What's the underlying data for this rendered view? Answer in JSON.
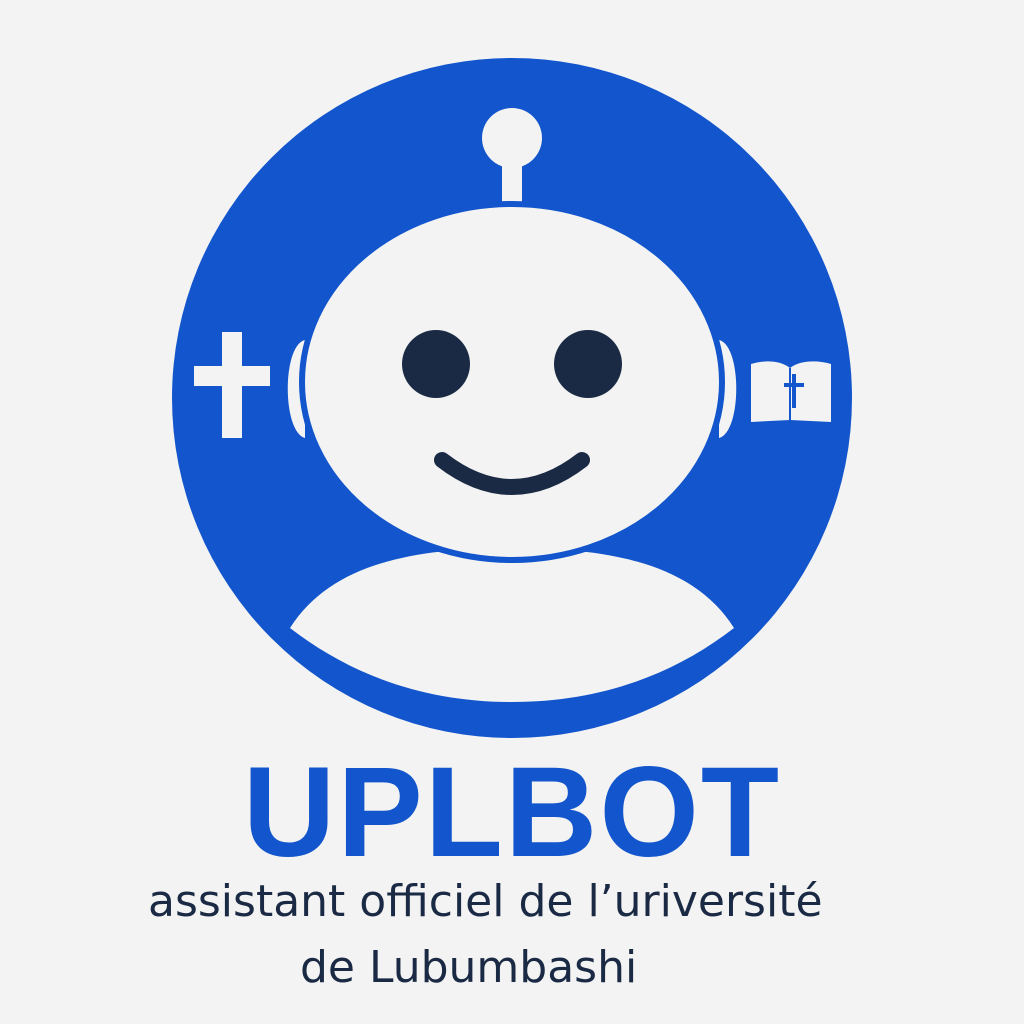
{
  "brand": {
    "title": "UPLBOT",
    "tagline_line1": "assistant officiel de l’uriversité",
    "tagline_line2": "de Lubumbashi"
  },
  "colors": {
    "brand_blue": "#1255cc",
    "face_white": "#f3f3f3",
    "eye_dark": "#1b2a44",
    "background": "#f3f3f3"
  },
  "icons": {
    "left": "cross-icon",
    "right": "bible-icon",
    "mascot": "robot-mascot"
  }
}
